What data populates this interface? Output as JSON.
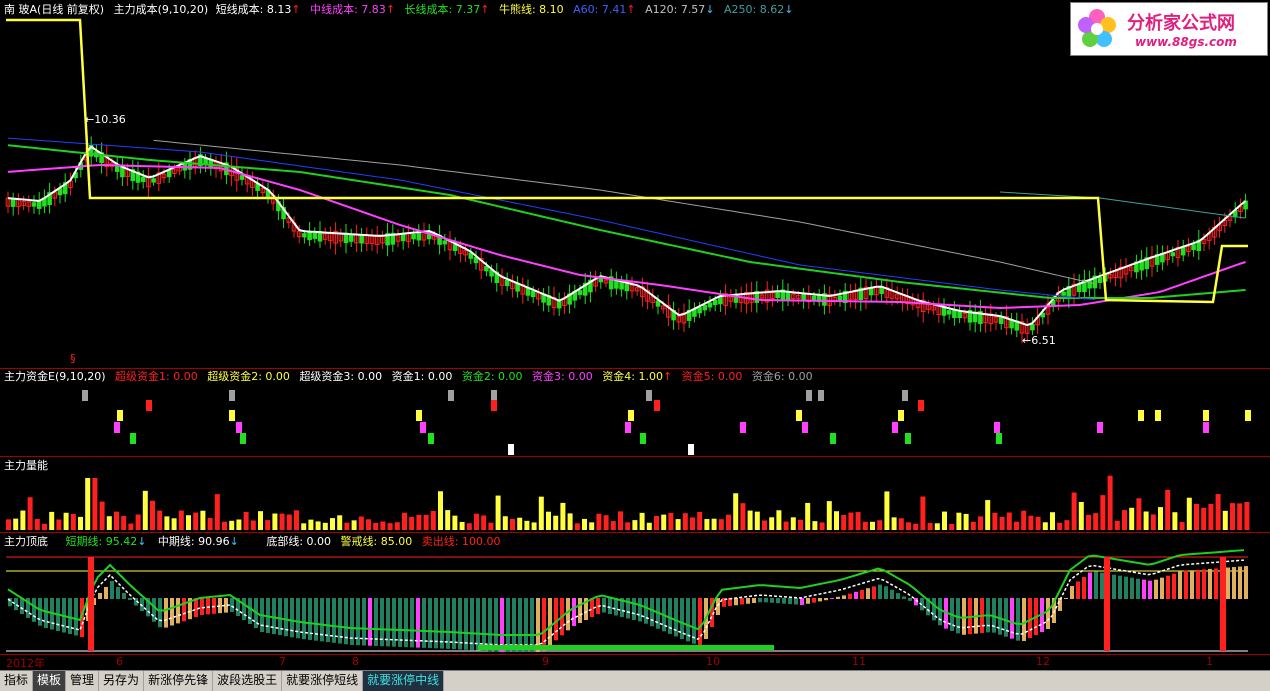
{
  "colors": {
    "up": "#ff2020",
    "down": "#20e020",
    "white": "#ffffff",
    "magenta": "#ff40ff",
    "green": "#20d020",
    "yellow": "#ffff40",
    "blue": "#2040ff",
    "grey": "#a0a0a0",
    "teal": "#40a0a0",
    "sep": "#a00000"
  },
  "panel1": {
    "ticker": "南 玻A(日线 前复权)",
    "indicator": "主力成本(9,10,20)",
    "short_label": "短线成本: 8.13",
    "mid_label": "中线成本: 7.83",
    "long_label": "长线成本: 7.37",
    "bull_label": "牛熊线: 8.10",
    "a60_label": "A60: 7.41",
    "a120_label": "A120: 7.57",
    "a250_label": "A250: 8.62",
    "high_note": "10.36",
    "low_note": "6.51",
    "marker": "§"
  },
  "panel2": {
    "indicator": "主力资金E(9,10,20)",
    "s1": "超级资金1: 0.00",
    "s2": "超级资金2: 0.00",
    "s3": "超级资金3: 0.00",
    "f1": "资金1: 0.00",
    "f2": "资金2: 0.00",
    "f3": "资金3: 0.00",
    "f4": "资金4: 1.00",
    "f5": "资金5: 0.00",
    "f6": "资金6: 0.00"
  },
  "panel3": {
    "indicator": "主力量能"
  },
  "panel4": {
    "indicator": "主力顶底",
    "short": "短期线: 95.42",
    "mid": "中期线: 90.96",
    "bottom": "底部线: 0.00",
    "warn": "警戒线: 85.00",
    "sell": "卖出线: 100.00"
  },
  "axis": [
    "2012年",
    "6",
    "7",
    "8",
    "9",
    "10",
    "11",
    "12",
    "1"
  ],
  "logo": {
    "name": "分析家公式网",
    "url": "www.88gs.com"
  },
  "tabs": [
    "指标",
    "模板",
    "管理",
    "另存为",
    "新涨停先锋",
    "波段选股王",
    "就要涨停短线",
    "就要涨停中线"
  ],
  "icons": {
    "up_arrow": "up-arrow-icon",
    "down_arrow": "down-arrow-icon",
    "flower": "flower-logo-icon"
  }
}
